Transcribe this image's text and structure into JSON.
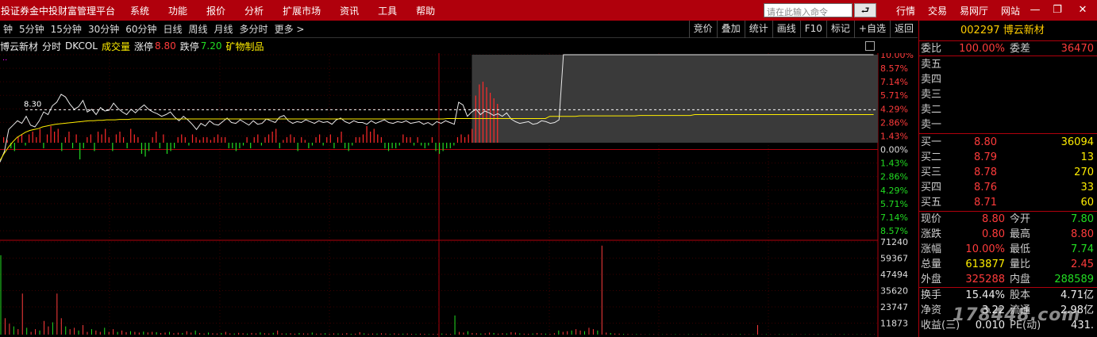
{
  "titlebar": {
    "app_title": "投证券金中投财富管理平台",
    "menu": [
      "系统",
      "功能",
      "报价",
      "分析",
      "扩展市场",
      "资讯",
      "工具",
      "帮助"
    ],
    "command_placeholder": "请在此输入命令",
    "enter_icon": "return-arrow-icon",
    "right_menu": [
      "行情",
      "交易",
      "易网厅",
      "网站"
    ],
    "window_controls": [
      "minimize-icon",
      "restore-icon",
      "close-icon"
    ]
  },
  "toolbar": {
    "periods": [
      "钟",
      "5分钟",
      "15分钟",
      "30分钟",
      "60分钟",
      "日线",
      "周线",
      "月线",
      "多分时",
      "更多 >"
    ],
    "tools": [
      "竞价",
      "叠加",
      "统计",
      "画线",
      "F10",
      "标记",
      "+自选",
      "返回"
    ]
  },
  "info": {
    "name": "博云新材",
    "mode": "分时",
    "indicator": "DKCOL",
    "volume_label": "成交量",
    "limit_up_label": "涨停",
    "limit_up": "8.80",
    "limit_down_label": "跌停",
    "limit_down": "7.20",
    "sector": "矿物制品"
  },
  "chart_data": {
    "type": "line",
    "prev_close": 8.0,
    "avg_marker_label": "8.30",
    "right_axis_top": [
      "10.00%",
      "8.57%",
      "7.14%",
      "5.71%",
      "4.29%",
      "2.86%",
      "1.43%",
      "0.00%",
      "1.43%",
      "2.86%",
      "4.29%",
      "5.71%",
      "7.14%",
      "8.57%"
    ],
    "right_axis_volume": [
      "71240",
      "59367",
      "47494",
      "35620",
      "23747",
      "11873"
    ],
    "volume_max": 71240,
    "price_pct": [
      -2.2,
      -1.0,
      1.5,
      2.0,
      2.5,
      2.2,
      3.0,
      2.0,
      1.8,
      2.5,
      3.5,
      3.2,
      4.2,
      4.6,
      5.5,
      5.2,
      4.4,
      3.8,
      4.1,
      4.8,
      3.5,
      3.8,
      3.2,
      4.0,
      3.6,
      3.7,
      4.5,
      3.9,
      3.5,
      3.2,
      3.8,
      3.4,
      3.9,
      4.3,
      3.8,
      3.5,
      3.3,
      3.0,
      3.2,
      3.5,
      2.9,
      2.5,
      3.0,
      2.6,
      2.1,
      1.5,
      2.2,
      1.9,
      2.5,
      2.1,
      2.0,
      2.4,
      2.8,
      2.3,
      2.2,
      2.6,
      2.3,
      2.0,
      2.5,
      2.1,
      2.2,
      2.7,
      2.5,
      2.3,
      2.9,
      3.1,
      2.5,
      2.2,
      2.4,
      2.3,
      2.6,
      2.4,
      2.2,
      2.5,
      2.3,
      2.4,
      2.1,
      2.6,
      2.8,
      2.4,
      2.2,
      2.5,
      2.3,
      2.3,
      2.1,
      2.5,
      2.2,
      2.4,
      2.6,
      2.3,
      2.2,
      2.4,
      2.3,
      2.5,
      2.2,
      2.3,
      2.4,
      2.1,
      2.3,
      2.0,
      2.4,
      2.2,
      2.5,
      2.3,
      2.1,
      4.6,
      4.3,
      3.0,
      3.5,
      3.8,
      3.2,
      3.6,
      3.4,
      3.1,
      3.3,
      3.0,
      3.4,
      2.7,
      2.4,
      2.2,
      2.3,
      2.4,
      2.1,
      2.2,
      2.5,
      2.4,
      2.2,
      2.3,
      2.6,
      10,
      10,
      10,
      10,
      10,
      10,
      10,
      10,
      10,
      10,
      10,
      10,
      10,
      10,
      10,
      10,
      10,
      10,
      10,
      10,
      10,
      10,
      10,
      10,
      10,
      10,
      10,
      10,
      10,
      10,
      10,
      10,
      10,
      10,
      10,
      10,
      10,
      10,
      10,
      10,
      10,
      10,
      10,
      10,
      10,
      10,
      10,
      10,
      10,
      10,
      10,
      10,
      10,
      10,
      10,
      10,
      10,
      10,
      10,
      10,
      10,
      10,
      10,
      10,
      10,
      10,
      10,
      10,
      10,
      10,
      10,
      10
    ],
    "avg_pct": [
      -2.0,
      -1.2,
      -0.5,
      0.1,
      0.6,
      0.9,
      1.2,
      1.4,
      1.5,
      1.6,
      1.8,
      1.9,
      2.0,
      2.1,
      2.15,
      2.2,
      2.25,
      2.3,
      2.35,
      2.4,
      2.45,
      2.5,
      2.5,
      2.55,
      2.55,
      2.6,
      2.6,
      2.6,
      2.65,
      2.65,
      2.65,
      2.7,
      2.7,
      2.7,
      2.7,
      2.7,
      2.7,
      2.7,
      2.7,
      2.7,
      2.7,
      2.7,
      2.7,
      2.7,
      2.7,
      2.7,
      2.7,
      2.7,
      2.7,
      2.7,
      2.7,
      2.7,
      2.7,
      2.7,
      2.7,
      2.7,
      2.7,
      2.7,
      2.7,
      2.7,
      2.7,
      2.7,
      2.7,
      2.7,
      2.7,
      2.7,
      2.7,
      2.7,
      2.7,
      2.7,
      2.7,
      2.7,
      2.7,
      2.7,
      2.7,
      2.7,
      2.7,
      2.7,
      2.7,
      2.7,
      2.7,
      2.7,
      2.7,
      2.7,
      2.7,
      2.7,
      2.7,
      2.7,
      2.7,
      2.7,
      2.7,
      2.7,
      2.7,
      2.7,
      2.7,
      2.7,
      2.7,
      2.7,
      2.7,
      2.7,
      2.7,
      2.7,
      2.7,
      2.7,
      2.7,
      2.75,
      2.75,
      2.75,
      2.75,
      2.75,
      2.75,
      2.75,
      2.75,
      2.75,
      2.75,
      2.75,
      2.75,
      2.75,
      2.75,
      2.75,
      2.75,
      2.75,
      2.75,
      2.75,
      2.75,
      2.75,
      2.75,
      2.75,
      2.75,
      3.0,
      3.0,
      3.0,
      3.0,
      3.0,
      3.0,
      3.0,
      3.05,
      3.05,
      3.05,
      3.05,
      3.05,
      3.05,
      3.05,
      3.05,
      3.05,
      3.05,
      3.05,
      3.05,
      3.05,
      3.05,
      3.1,
      3.1,
      3.1,
      3.1,
      3.1,
      3.1,
      3.1,
      3.1,
      3.1,
      3.1,
      3.1,
      3.1,
      3.1,
      3.2,
      3.2,
      3.2,
      3.2,
      3.2,
      3.2,
      3.2,
      3.2,
      3.2,
      3.2,
      3.2,
      3.2,
      3.2,
      3.2,
      3.2,
      3.2,
      3.2,
      3.2,
      3.2,
      3.2,
      3.2,
      3.2,
      3.2,
      3.2,
      3.2,
      3.2,
      3.2,
      3.2,
      3.2,
      3.2,
      3.2,
      3.2,
      3.2,
      3.2,
      3.2,
      3.2,
      3.2,
      3.2,
      3.2,
      3.2,
      3.2,
      3.2,
      3.2
    ],
    "dkcol": [
      2,
      1,
      -2,
      -3,
      2,
      3,
      -1,
      3,
      4,
      2,
      5,
      -2,
      3,
      6,
      4,
      5,
      -3,
      2,
      4,
      -2,
      3,
      -6,
      -2,
      2,
      3,
      -3,
      4,
      3,
      5,
      2,
      -3,
      3,
      4,
      2,
      -2,
      5,
      3,
      2,
      -4,
      -5,
      -3,
      2,
      4,
      -2,
      3,
      -4,
      -3,
      -2,
      2,
      3,
      2,
      -1,
      3,
      2,
      1,
      2,
      2,
      1,
      2,
      3,
      2,
      2,
      -2,
      -2,
      -3,
      -2,
      -1,
      2,
      -2,
      2,
      3,
      -1,
      2,
      3,
      4,
      5,
      -2,
      1,
      2,
      3,
      2,
      -3,
      2,
      1,
      -2,
      -1,
      2,
      3,
      -1,
      2,
      3,
      -2,
      2,
      4,
      -2,
      -3,
      -1,
      2,
      2,
      3,
      6,
      4,
      5,
      3,
      2,
      -2,
      -3,
      -2,
      -2,
      -1,
      3,
      2,
      2,
      -1,
      2,
      -1,
      -2,
      -1,
      2,
      -3,
      -4,
      -3,
      -2,
      -2,
      -1,
      2,
      3,
      2,
      3,
      5,
      17,
      21,
      22,
      20,
      18,
      16,
      14
    ],
    "volume": [
      58000,
      12000,
      8000,
      6000,
      4000,
      30000,
      5000,
      2000,
      4000,
      3000,
      10000,
      6000,
      9000,
      30000,
      12000,
      6000,
      4000,
      5000,
      3000,
      7000,
      2000,
      4000,
      3000,
      2000,
      5000,
      2000,
      4000,
      2000,
      3000,
      1800,
      2500,
      2000,
      1500,
      2200,
      1600,
      2000,
      1800,
      1200,
      1500,
      2000,
      1000,
      1400,
      1200,
      2500,
      1500,
      3000,
      1200,
      800,
      1500,
      1000,
      800,
      1200,
      2000,
      900,
      800,
      1300,
      1000,
      700,
      1200,
      900,
      1600,
      1000,
      800,
      1300,
      3000,
      900,
      800,
      1000,
      700,
      1200,
      900,
      800,
      1500,
      700,
      800,
      1000,
      600,
      900,
      800,
      700,
      1100,
      600,
      700,
      1800,
      900,
      600,
      800,
      700,
      1000,
      800,
      500,
      900,
      600,
      700,
      800,
      600,
      500,
      700,
      600,
      400,
      600,
      500,
      800,
      600,
      500,
      14000,
      2000,
      1500,
      2500,
      1200,
      1000,
      800,
      900,
      1500,
      1200,
      700,
      1000,
      800,
      1800,
      1500,
      900,
      700,
      600,
      800,
      1200,
      900,
      700,
      600,
      1000,
      3000,
      2000,
      2500,
      3000,
      4000,
      3000,
      2500,
      5000,
      4000,
      3000,
      65000,
      1500,
      1200,
      800,
      700,
      500,
      400,
      300,
      400,
      300,
      200,
      200,
      300,
      200,
      200,
      300,
      200,
      300,
      200,
      200,
      300,
      200,
      200,
      300,
      300,
      200,
      200,
      200,
      300,
      200,
      300,
      200,
      400,
      300,
      200,
      300,
      7000,
      200,
      300,
      200,
      200,
      300,
      200,
      200,
      300,
      200,
      200,
      200,
      200,
      200,
      300,
      200,
      200,
      200,
      200,
      200,
      300,
      200,
      200,
      200,
      200,
      200,
      200,
      200
    ]
  },
  "panel": {
    "code": "002297",
    "name": "博云新材",
    "wei_bi_label": "委比",
    "wei_bi": "100.00%",
    "wei_cha_label": "委差",
    "wei_cha": "36470",
    "sells": [
      {
        "label": "卖五"
      },
      {
        "label": "卖四"
      },
      {
        "label": "卖三"
      },
      {
        "label": "卖二"
      },
      {
        "label": "卖一"
      }
    ],
    "buys": [
      {
        "label": "买一",
        "price": "8.80",
        "vol": "36094"
      },
      {
        "label": "买二",
        "price": "8.79",
        "vol": "13"
      },
      {
        "label": "买三",
        "price": "8.78",
        "vol": "270"
      },
      {
        "label": "买四",
        "price": "8.76",
        "vol": "33"
      },
      {
        "label": "买五",
        "price": "8.71",
        "vol": "60"
      }
    ],
    "stats": [
      {
        "l1": "现价",
        "v1": "8.80",
        "c1": "red",
        "l2": "今开",
        "v2": "7.80",
        "c2": "green"
      },
      {
        "l1": "涨跌",
        "v1": "0.80",
        "c1": "red",
        "l2": "最高",
        "v2": "8.80",
        "c2": "red"
      },
      {
        "l1": "涨幅",
        "v1": "10.00%",
        "c1": "red",
        "l2": "最低",
        "v2": "7.74",
        "c2": "green"
      },
      {
        "l1": "总量",
        "v1": "613877",
        "c1": "yellow",
        "l2": "量比",
        "v2": "2.45",
        "c2": "red"
      },
      {
        "l1": "外盘",
        "v1": "325288",
        "c1": "red",
        "l2": "内盘",
        "v2": "288589",
        "c2": "green"
      }
    ],
    "stats2": [
      {
        "l1": "换手",
        "v1": "15.44%",
        "l2": "股本",
        "v2": "4.71亿"
      },
      {
        "l1": "净资",
        "v1": "3.22",
        "l2": "流通",
        "v2": "2.98亿"
      },
      {
        "l1": "收益(三)",
        "v1": "0.010",
        "l2": "PE(动)",
        "v2": "431."
      }
    ],
    "watermark": "178448.com"
  }
}
